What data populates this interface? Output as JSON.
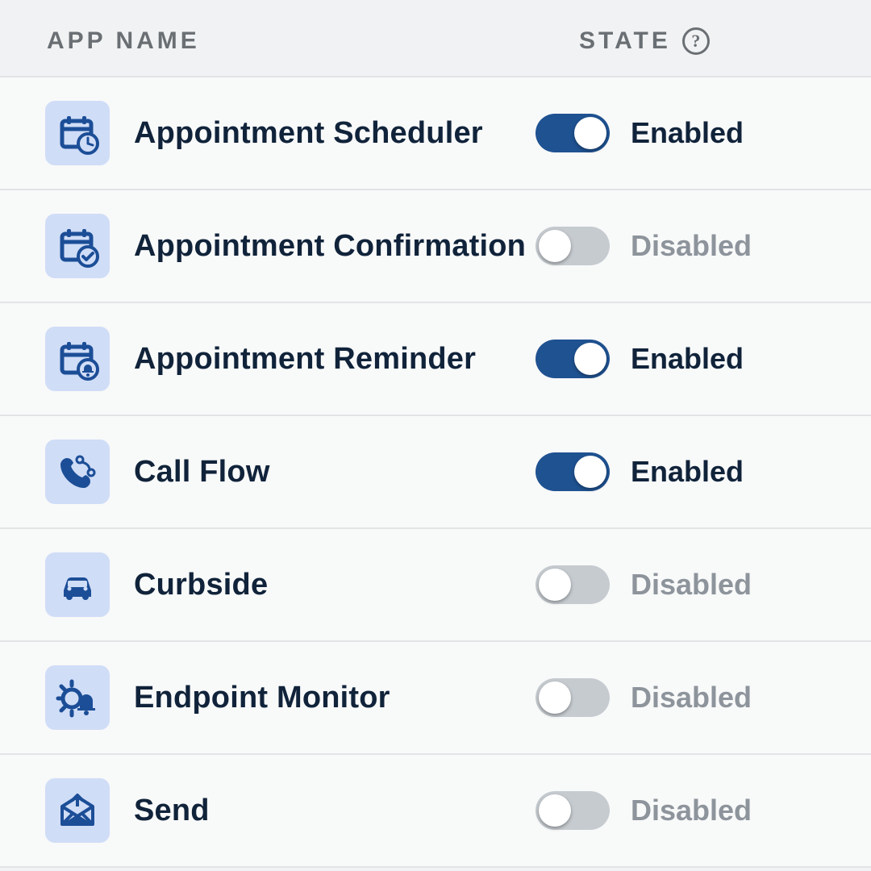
{
  "header": {
    "appname_label": "APP NAME",
    "state_label": "STATE"
  },
  "state_text": {
    "enabled": "Enabled",
    "disabled": "Disabled"
  },
  "apps": [
    {
      "icon": "calendar-clock-icon",
      "label": "Appointment Scheduler",
      "enabled": true
    },
    {
      "icon": "calendar-check-icon",
      "label": "Appointment Confirmation",
      "enabled": false
    },
    {
      "icon": "calendar-bell-icon",
      "label": "Appointment Reminder",
      "enabled": true
    },
    {
      "icon": "phone-flow-icon",
      "label": "Call Flow",
      "enabled": true
    },
    {
      "icon": "car-icon",
      "label": "Curbside",
      "enabled": false
    },
    {
      "icon": "gear-bell-icon",
      "label": "Endpoint Monitor",
      "enabled": false
    },
    {
      "icon": "mail-send-icon",
      "label": "Send",
      "enabled": false
    }
  ]
}
